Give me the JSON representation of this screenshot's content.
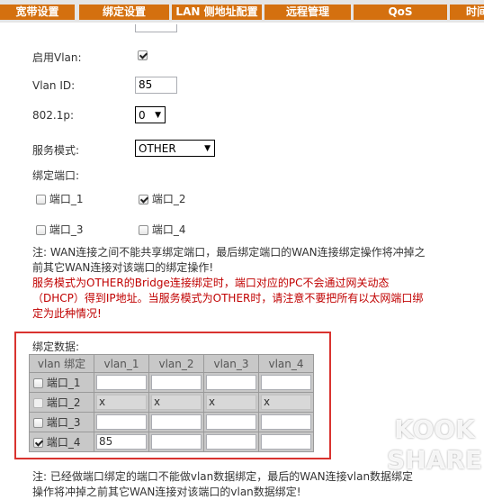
{
  "tabs": [
    "宽带设置",
    "绑定设置",
    "LAN 侧地址配置",
    "远程管理",
    "QoS",
    "时间"
  ],
  "form": {
    "enable_vlan_label": "启用Vlan:",
    "vlan_id_label": "Vlan ID:",
    "vlan_id_value": "85",
    "dot1p_label": "802.1p:",
    "dot1p_value": "0",
    "service_mode_label": "服务模式:",
    "service_mode_value": "OTHER",
    "bind_ports_label": "绑定端口:",
    "ports": [
      {
        "label": "端口_1",
        "checked": false
      },
      {
        "label": "端口_2",
        "checked": true
      },
      {
        "label": "端口_3",
        "checked": false
      },
      {
        "label": "端口_4",
        "checked": false
      }
    ]
  },
  "notes": {
    "note1": "注: WAN连接之间不能共享绑定端口，最后绑定端口的WAN连接绑定操作将冲掉之前其它WAN连接对该端口的绑定操作!",
    "note2": "服务模式为OTHER的Bridge连接绑定时，端口对应的PC不会通过网关动态（DHCP）得到IP地址。当服务模式为OTHER时，请注意不要把所有以太网端口绑定为此种情况!",
    "note3": "注: 已经做端口绑定的端口不能做vlan数据绑定，最后的WAN连接vlan数据绑定操作将冲掉之前其它WAN连接对该端口的vlan数据绑定!"
  },
  "binding_table": {
    "label": "绑定数据:",
    "headers": [
      "vlan 绑定",
      "vlan_1",
      "vlan_2",
      "vlan_3",
      "vlan_4"
    ],
    "rows": [
      {
        "port": "端口_1",
        "checked": false,
        "disabled": false,
        "values": [
          "",
          "",
          "",
          ""
        ]
      },
      {
        "port": "端口_2",
        "checked": false,
        "disabled": true,
        "values": [
          "x",
          "x",
          "x",
          "x"
        ]
      },
      {
        "port": "端口_3",
        "checked": false,
        "disabled": false,
        "values": [
          "",
          "",
          "",
          ""
        ]
      },
      {
        "port": "端口_4",
        "checked": true,
        "disabled": false,
        "values": [
          "85",
          "",
          "",
          ""
        ]
      }
    ]
  },
  "watermark": {
    "line1": "KOOK",
    "line2": "SHARE"
  }
}
